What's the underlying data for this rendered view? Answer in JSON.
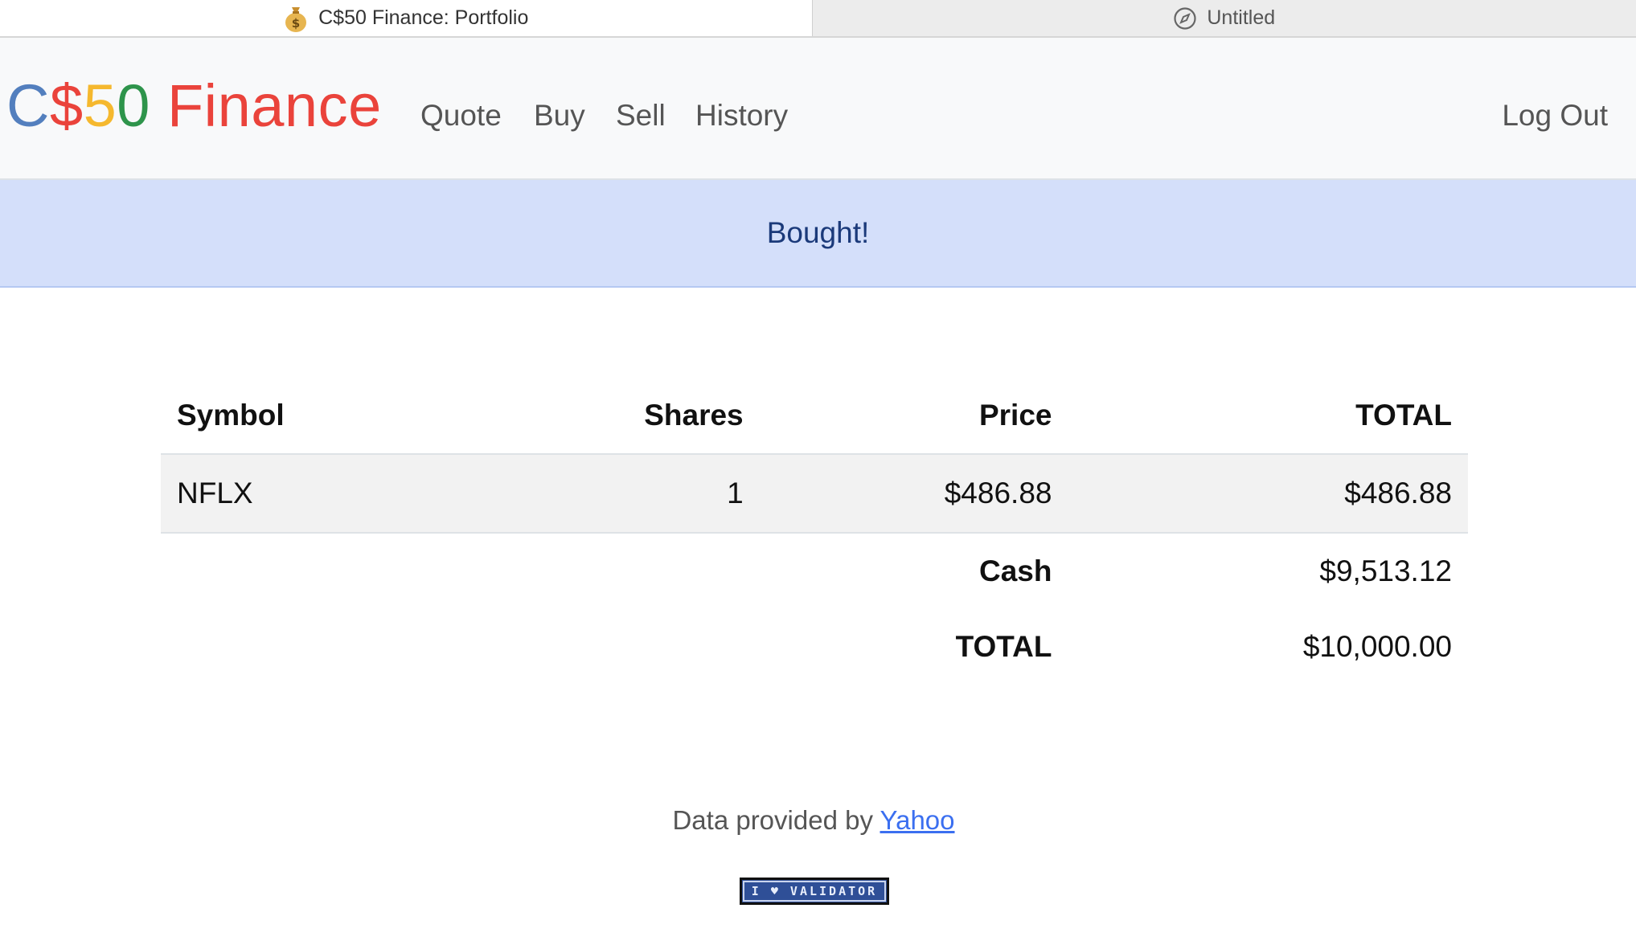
{
  "browser": {
    "tabs": [
      {
        "title": "C$50 Finance: Portfolio",
        "icon": "money-bag-icon",
        "active": true
      },
      {
        "title": "Untitled",
        "icon": "compass-icon",
        "active": false
      }
    ]
  },
  "navbar": {
    "brand": {
      "part1": "C",
      "part2": "$",
      "part3": "5",
      "part4": "0",
      "part5": " Finance"
    },
    "links": {
      "quote": "Quote",
      "buy": "Buy",
      "sell": "Sell",
      "history": "History"
    },
    "logout": "Log Out"
  },
  "alert": {
    "message": "Bought!"
  },
  "table": {
    "headers": {
      "symbol": "Symbol",
      "shares": "Shares",
      "price": "Price",
      "total": "TOTAL"
    },
    "rows": [
      {
        "symbol": "NFLX",
        "shares": "1",
        "price": "$486.88",
        "total": "$486.88"
      }
    ],
    "cash_label": "Cash",
    "cash_value": "$9,513.12",
    "grand_total_label": "TOTAL",
    "grand_total_value": "$10,000.00"
  },
  "footer": {
    "prefix": "Data provided by",
    "link_text": "Yahoo",
    "badge_text": "I ♥ VALIDATOR"
  },
  "colors": {
    "brand_blue": "#537fbe",
    "brand_red": "#ea433b",
    "brand_yellow": "#f5b82e",
    "brand_green": "#2e944b",
    "alert_bg": "#d4dffa",
    "link": "#3b6ff0"
  }
}
